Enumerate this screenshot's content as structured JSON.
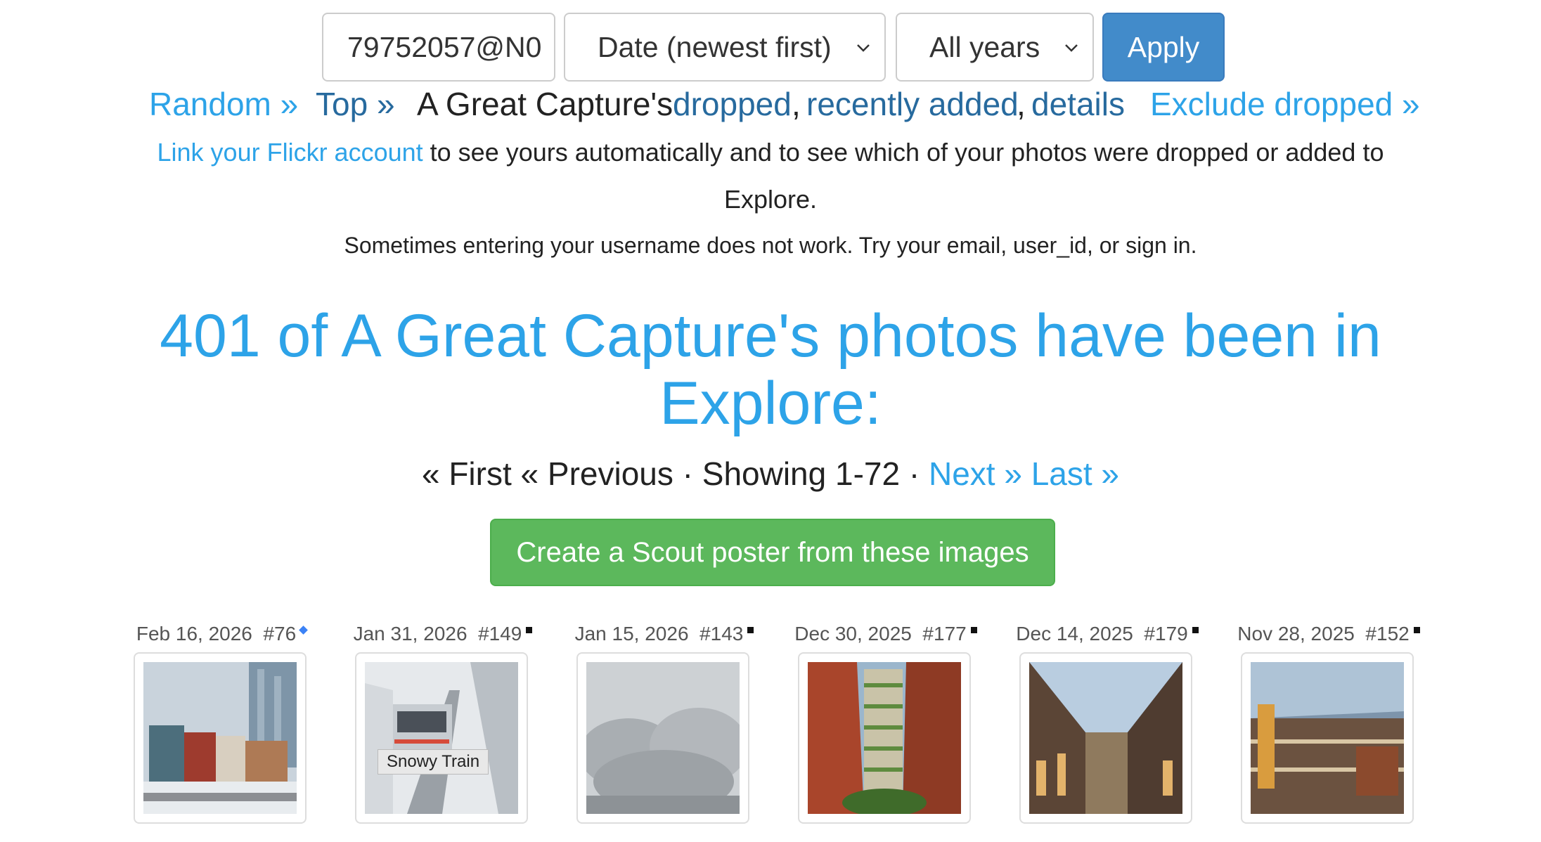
{
  "filters": {
    "user_value": "79752057@N0",
    "sort_value": "Date (newest first)",
    "year_value": "All years",
    "apply_label": "Apply"
  },
  "nav": {
    "random": "Random »",
    "top": "Top »",
    "owner_prefix": "A Great Capture's",
    "dropped": "dropped",
    "recently_added": "recently added",
    "details": "details",
    "exclude_dropped": "Exclude dropped »"
  },
  "info": {
    "link_text": "Link your Flickr account",
    "rest_line1": "to see yours automatically and to see which of your photos were dropped or added to",
    "line2": "Explore.",
    "hint": "Sometimes entering your username does not work. Try your email, user_id, or sign in."
  },
  "headline": {
    "line1": "401 of A Great Capture's photos have been in",
    "line2": "Explore:"
  },
  "pager": {
    "first": "« First",
    "previous": "« Previous",
    "showing": "Showing 1-72",
    "next": "Next »",
    "last": "Last »"
  },
  "poster_button": "Create a Scout poster from these images",
  "photos": [
    {
      "date": "Feb 16, 2026",
      "rank": "#76",
      "marker": "blue-diamond-icon"
    },
    {
      "date": "Jan 31, 2026",
      "rank": "#149",
      "marker": "black-square-icon",
      "tooltip": "Snowy Train"
    },
    {
      "date": "Jan 15, 2026",
      "rank": "#143",
      "marker": "black-square-icon"
    },
    {
      "date": "Dec 30, 2025",
      "rank": "#177",
      "marker": "black-square-icon"
    },
    {
      "date": "Dec 14, 2025",
      "rank": "#179",
      "marker": "black-square-icon"
    },
    {
      "date": "Nov 28, 2025",
      "rank": "#152",
      "marker": "black-square-icon"
    }
  ],
  "colors": {
    "link": "#2da3e8",
    "visited_link": "#276a9e",
    "apply_bg": "#428bca",
    "poster_bg": "#5cb85c"
  }
}
